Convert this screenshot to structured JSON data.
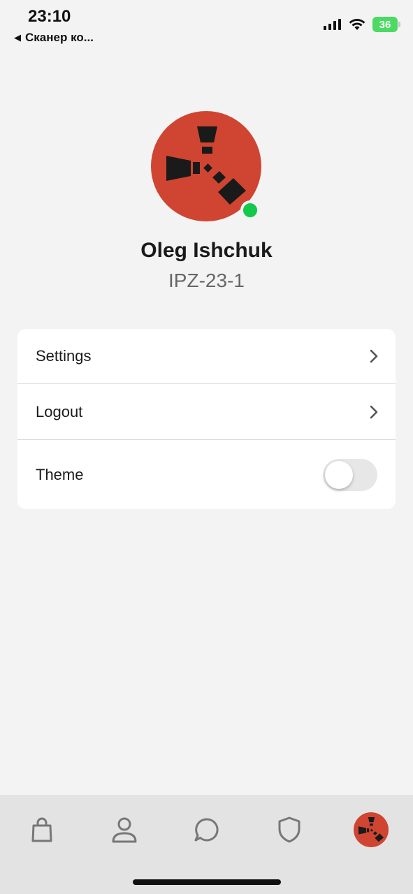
{
  "status_bar": {
    "time": "23:10",
    "back_label": "Сканер ко...",
    "battery": "36"
  },
  "profile": {
    "name": "Oleg Ishchuk",
    "group": "IPZ-23-1",
    "online": true,
    "avatar_icon": "rust-logo-icon"
  },
  "menu": {
    "items": [
      {
        "label": "Settings",
        "icon": "chevron-right-icon"
      },
      {
        "label": "Logout",
        "icon": "chevron-right-icon"
      },
      {
        "label": "Theme",
        "toggle_on": false
      }
    ]
  },
  "tab_bar": {
    "tabs": [
      {
        "icon": "shopping-bag-icon"
      },
      {
        "icon": "person-icon"
      },
      {
        "icon": "chat-bubble-icon"
      },
      {
        "icon": "shield-icon"
      },
      {
        "icon": "profile-avatar-icon",
        "active": true
      }
    ]
  },
  "colors": {
    "background": "#f3f3f3",
    "avatar_red": "#cf4531",
    "online_green": "#12c94a",
    "tab_bar_bg": "#e3e3e3"
  }
}
